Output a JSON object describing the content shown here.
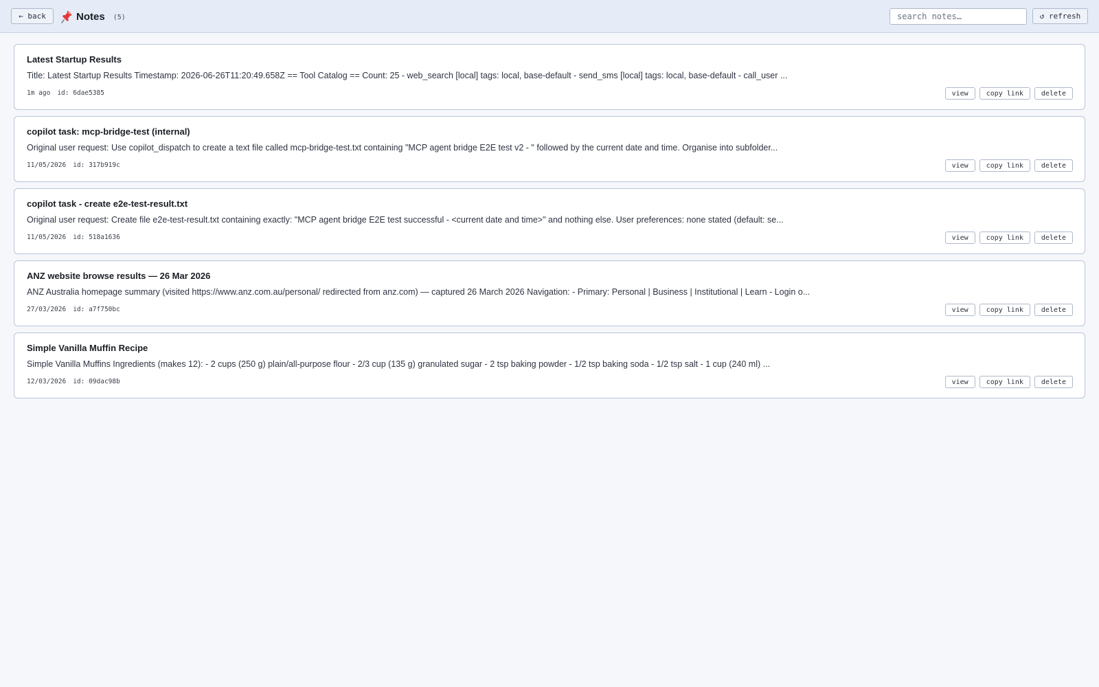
{
  "header": {
    "back_label": "← back",
    "title": "Notes",
    "count": "(5)",
    "search_placeholder": "search notes…",
    "refresh_label": "↺ refresh",
    "icon": "pushpin-icon"
  },
  "actions": {
    "view_label": "view",
    "copy_link_label": "copy link",
    "delete_label": "delete"
  },
  "notes": [
    {
      "title": "Latest Startup Results",
      "preview": "Title: Latest Startup Results Timestamp: 2026-06-26T11:20:49.658Z == Tool Catalog == Count: 25 - web_search [local] tags: local, base-default - send_sms [local] tags: local, base-default - call_user ...",
      "date": "1m ago",
      "id": "id: 6dae5385"
    },
    {
      "title": "copilot task: mcp-bridge-test (internal)",
      "preview": "Original user request: Use copilot_dispatch to create a text file called mcp-bridge-test.txt containing \"MCP agent bridge E2E test v2 - \" followed by the current date and time. Organise into subfolder...",
      "date": "11/05/2026",
      "id": "id: 317b919c"
    },
    {
      "title": "copilot task - create e2e-test-result.txt",
      "preview": "Original user request: Create file e2e-test-result.txt containing exactly: \"MCP agent bridge E2E test successful - <current date and time>\" and nothing else. User preferences: none stated (default: se...",
      "date": "11/05/2026",
      "id": "id: 518a1636"
    },
    {
      "title": "ANZ website browse results — 26 Mar 2026",
      "preview": "ANZ Australia homepage summary (visited https://www.anz.com.au/personal/ redirected from anz.com) — captured 26 March 2026 Navigation: - Primary: Personal | Business | Institutional | Learn - Login o...",
      "date": "27/03/2026",
      "id": "id: a7f750bc"
    },
    {
      "title": "Simple Vanilla Muffin Recipe",
      "preview": "Simple Vanilla Muffins Ingredients (makes 12): - 2 cups (250 g) plain/all-purpose flour - 2/3 cup (135 g) granulated sugar - 2 tsp baking powder - 1/2 tsp baking soda - 1/2 tsp salt - 1 cup (240 ml) ...",
      "date": "12/03/2026",
      "id": "id: 09dac98b"
    }
  ]
}
